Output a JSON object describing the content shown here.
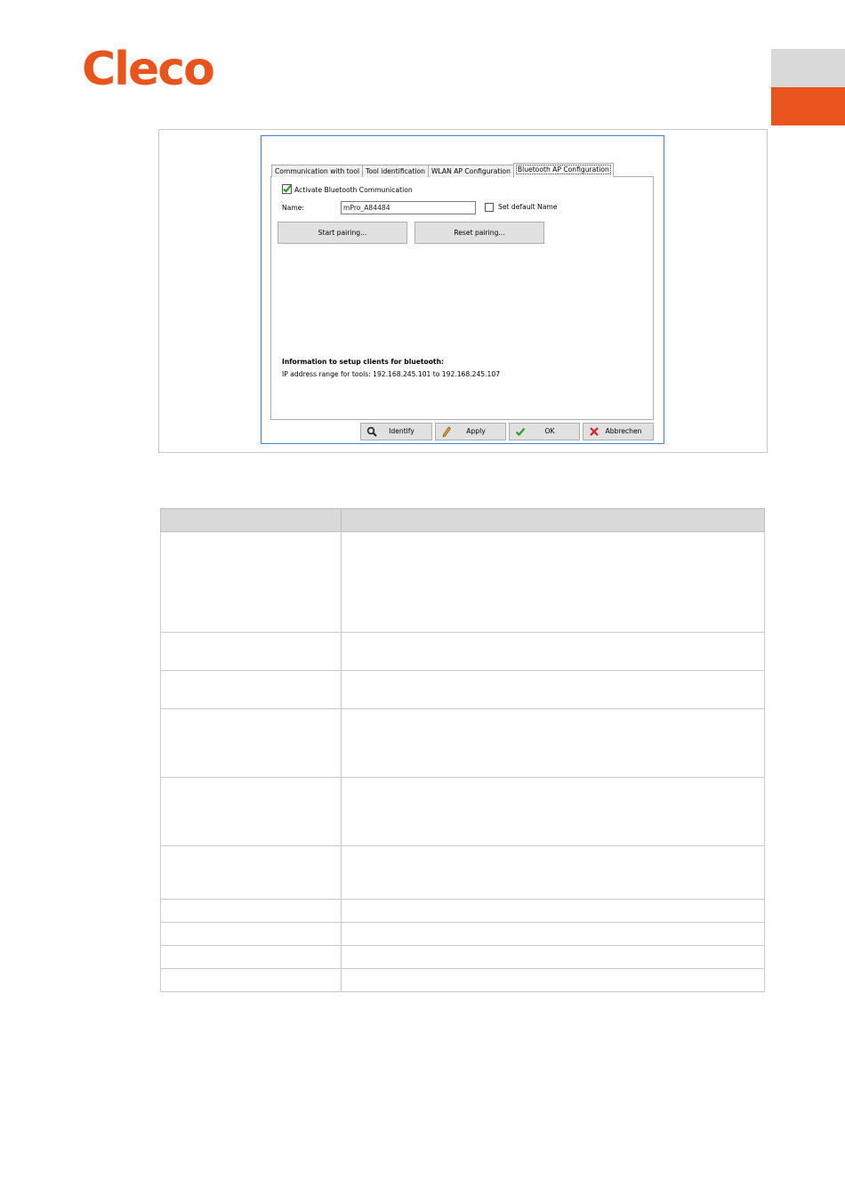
{
  "brand": {
    "logo_text": "Cleco",
    "accent_color": "#e8541c"
  },
  "dialog": {
    "tabs": [
      {
        "label": "Communication with tool",
        "active": false
      },
      {
        "label": "Tool identification",
        "active": false
      },
      {
        "label": "WLAN AP Configuration",
        "active": false
      },
      {
        "label": "Bluetooth AP Configuration",
        "active": true
      }
    ],
    "activate_label": "Activate Bluetooth Communication",
    "activate_checked": true,
    "name_label": "Name:",
    "name_value": "mPro_A84484",
    "default_name_label": "Set default Name",
    "default_name_checked": false,
    "start_pairing_label": "Start pairing...",
    "reset_pairing_label": "Reset pairing...",
    "info_heading": "Information to setup clients for bluetooth:",
    "info_text": "IP address range for tools: 192.168.245.101 to 192.168.245.107",
    "footer": {
      "identify": "Identify",
      "apply": "Apply",
      "ok": "OK",
      "cancel": "Abbrechen"
    }
  },
  "table": {
    "row_count": 10
  }
}
